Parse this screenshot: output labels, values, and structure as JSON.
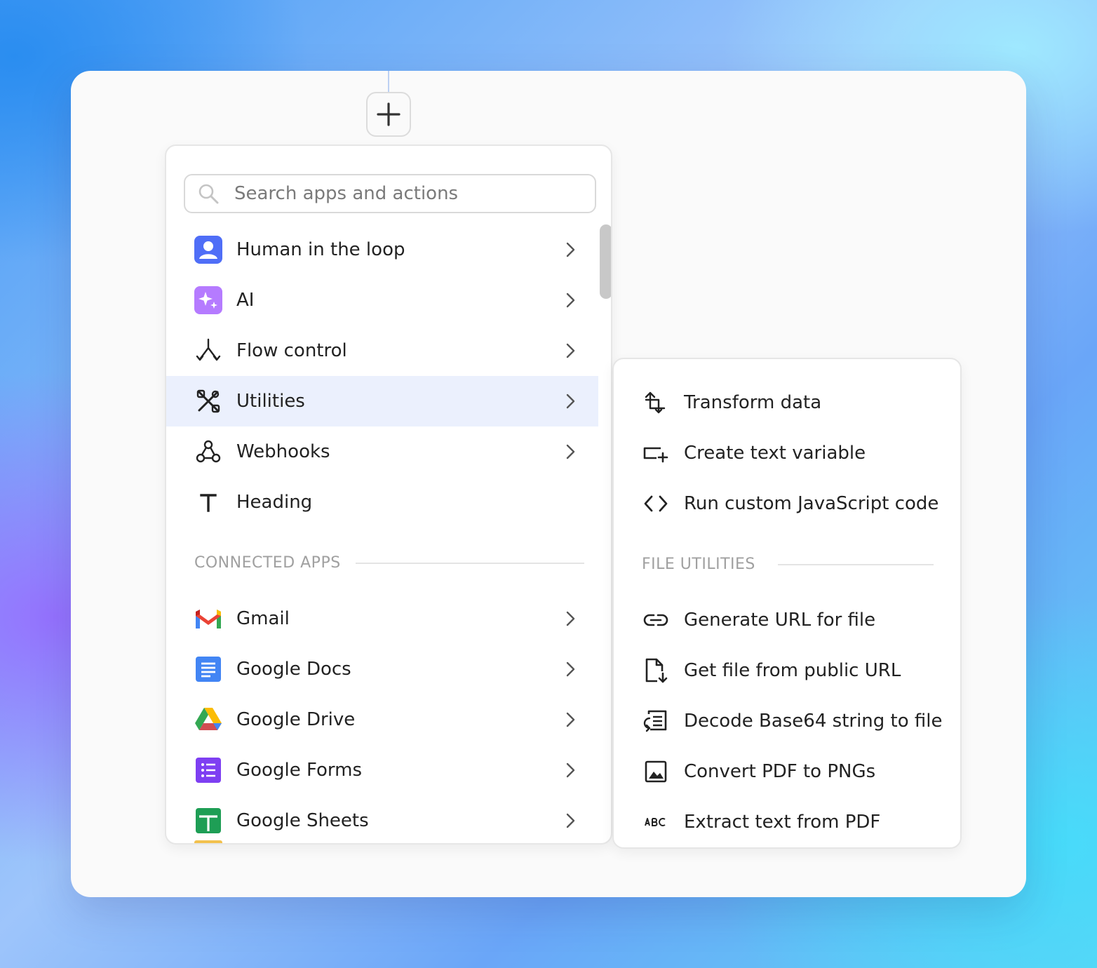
{
  "add_button": {
    "icon": "plus-icon"
  },
  "search": {
    "placeholder": "Search apps and actions",
    "value": ""
  },
  "menu": {
    "items": [
      {
        "label": "Human in the loop",
        "icon": "person-icon",
        "has_submenu": true
      },
      {
        "label": "AI",
        "icon": "sparkles-icon",
        "has_submenu": true
      },
      {
        "label": "Flow control",
        "icon": "branch-icon",
        "has_submenu": true
      },
      {
        "label": "Utilities",
        "icon": "tools-icon",
        "has_submenu": true,
        "active": true
      },
      {
        "label": "Webhooks",
        "icon": "webhook-icon",
        "has_submenu": true
      },
      {
        "label": "Heading",
        "icon": "text-heading-icon",
        "has_submenu": false
      }
    ],
    "connected_apps_title": "CONNECTED APPS",
    "apps": [
      {
        "label": "Gmail",
        "icon": "gmail-icon"
      },
      {
        "label": "Google Docs",
        "icon": "google-docs-icon"
      },
      {
        "label": "Google Drive",
        "icon": "google-drive-icon"
      },
      {
        "label": "Google Forms",
        "icon": "google-forms-icon"
      },
      {
        "label": "Google Sheets",
        "icon": "google-sheets-icon"
      }
    ]
  },
  "submenu": {
    "items": [
      {
        "label": "Transform data",
        "icon": "transform-icon"
      },
      {
        "label": "Create text variable",
        "icon": "text-variable-icon"
      },
      {
        "label": "Run custom JavaScript code",
        "icon": "code-icon"
      }
    ],
    "file_utilities_title": "FILE UTILITIES",
    "file_items": [
      {
        "label": "Generate URL for file",
        "icon": "link-icon"
      },
      {
        "label": "Get file from public URL",
        "icon": "file-download-icon"
      },
      {
        "label": "Decode Base64 string to file",
        "icon": "decode-icon"
      },
      {
        "label": "Convert PDF to PNGs",
        "icon": "image-icon"
      },
      {
        "label": "Extract text from PDF",
        "icon": "abc-icon"
      }
    ]
  },
  "colors": {
    "accent_highlight": "#ebf0fd",
    "human_icon_bg": "#4f6ef7",
    "ai_icon_bg": "#b57bff"
  }
}
